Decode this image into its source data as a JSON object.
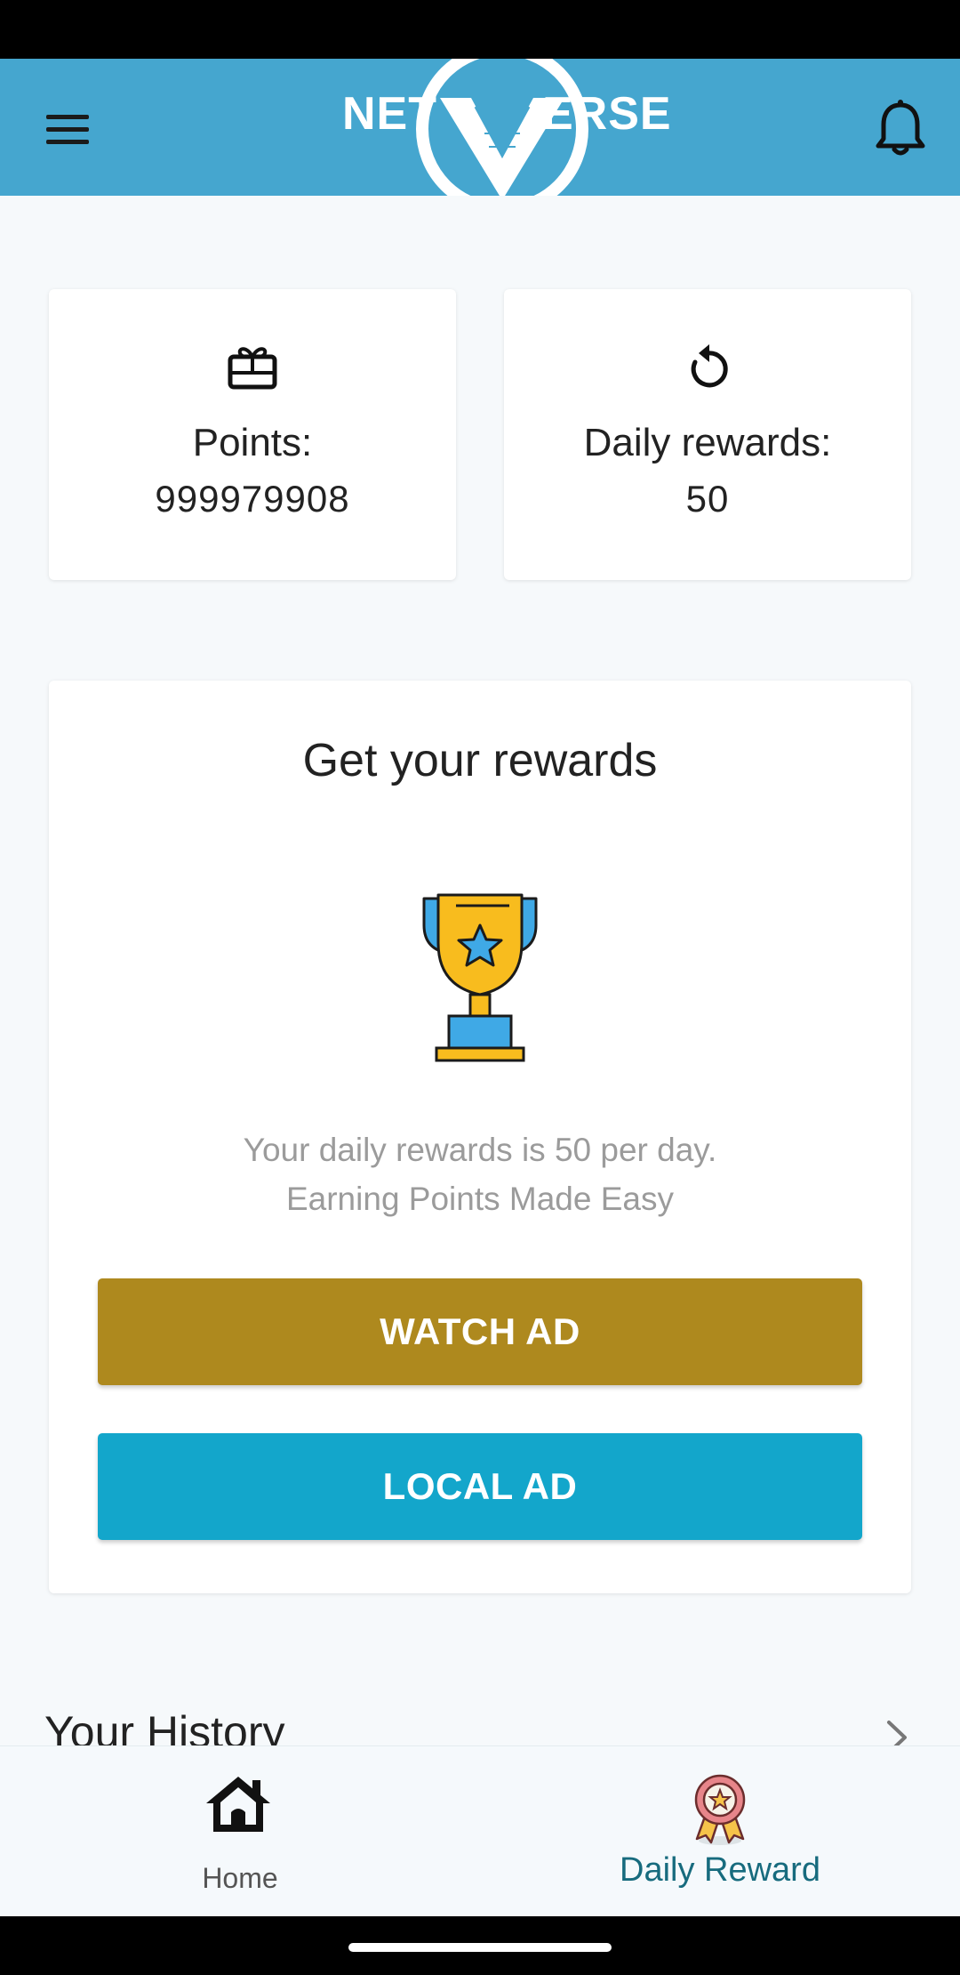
{
  "app_bar": {
    "logo_text_left": "NET",
    "logo_text_right": "ERSE",
    "menu_icon": "hamburger-menu-icon",
    "bell_icon": "bell-icon"
  },
  "stats": {
    "points": {
      "icon": "gift-card-icon",
      "label": "Points:",
      "value": "999979908"
    },
    "daily": {
      "icon": "refresh-icon",
      "label": "Daily rewards:",
      "value": "50"
    }
  },
  "reward": {
    "title": "Get your rewards",
    "trophy_icon": "trophy-icon",
    "description_line1": "Your daily rewards is 50 per day.",
    "description_line2": "Earning Points Made Easy",
    "watch_ad_label": "WATCH AD",
    "local_ad_label": "LOCAL AD"
  },
  "history": {
    "title": "Your History",
    "chevron_icon": "chevron-right-icon"
  },
  "bottom_nav": {
    "home": {
      "icon": "home-icon",
      "label": "Home"
    },
    "daily_reward": {
      "icon": "award-ribbon-icon",
      "label": "Daily Reward"
    }
  },
  "colors": {
    "app_bar": "#45a6cf",
    "watch_ad": "#ae891e",
    "local_ad": "#13a6cb",
    "active_nav": "#176b7e"
  }
}
